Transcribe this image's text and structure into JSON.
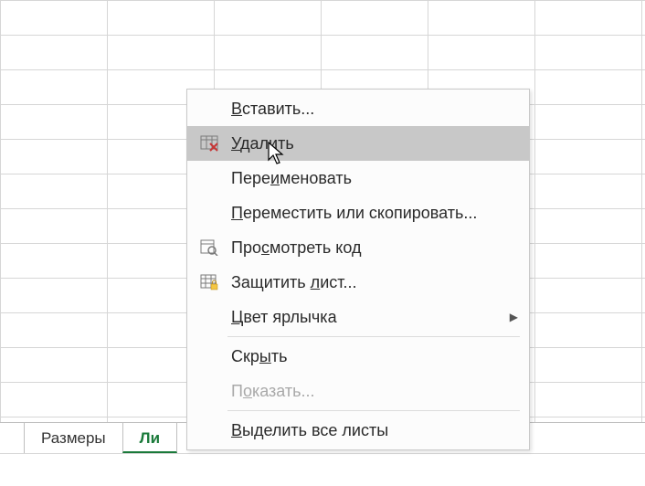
{
  "tabs": {
    "tab1": "Размеры",
    "tab2_visible": "Ли"
  },
  "menu": {
    "insert": {
      "pre": "",
      "u": "В",
      "post": "ставить..."
    },
    "delete": {
      "pre": "",
      "u": "У",
      "post": "далить"
    },
    "rename": {
      "pre": "Пере",
      "u": "и",
      "post": "меновать"
    },
    "move": {
      "pre": "",
      "u": "П",
      "post": "ереместить или скопировать..."
    },
    "viewcode": {
      "pre": "Про",
      "u": "с",
      "post": "мотреть код"
    },
    "protect": {
      "pre": "Защитить ",
      "u": "л",
      "post": "ист..."
    },
    "tabcolor": {
      "pre": "",
      "u": "Ц",
      "post": "вет ярлычка"
    },
    "hide": {
      "pre": "Скр",
      "u": "ы",
      "post": "ть"
    },
    "show": {
      "pre": "П",
      "u": "о",
      "post": "казать..."
    },
    "selectall": {
      "pre": "",
      "u": "В",
      "post": "ыделить все листы"
    }
  }
}
